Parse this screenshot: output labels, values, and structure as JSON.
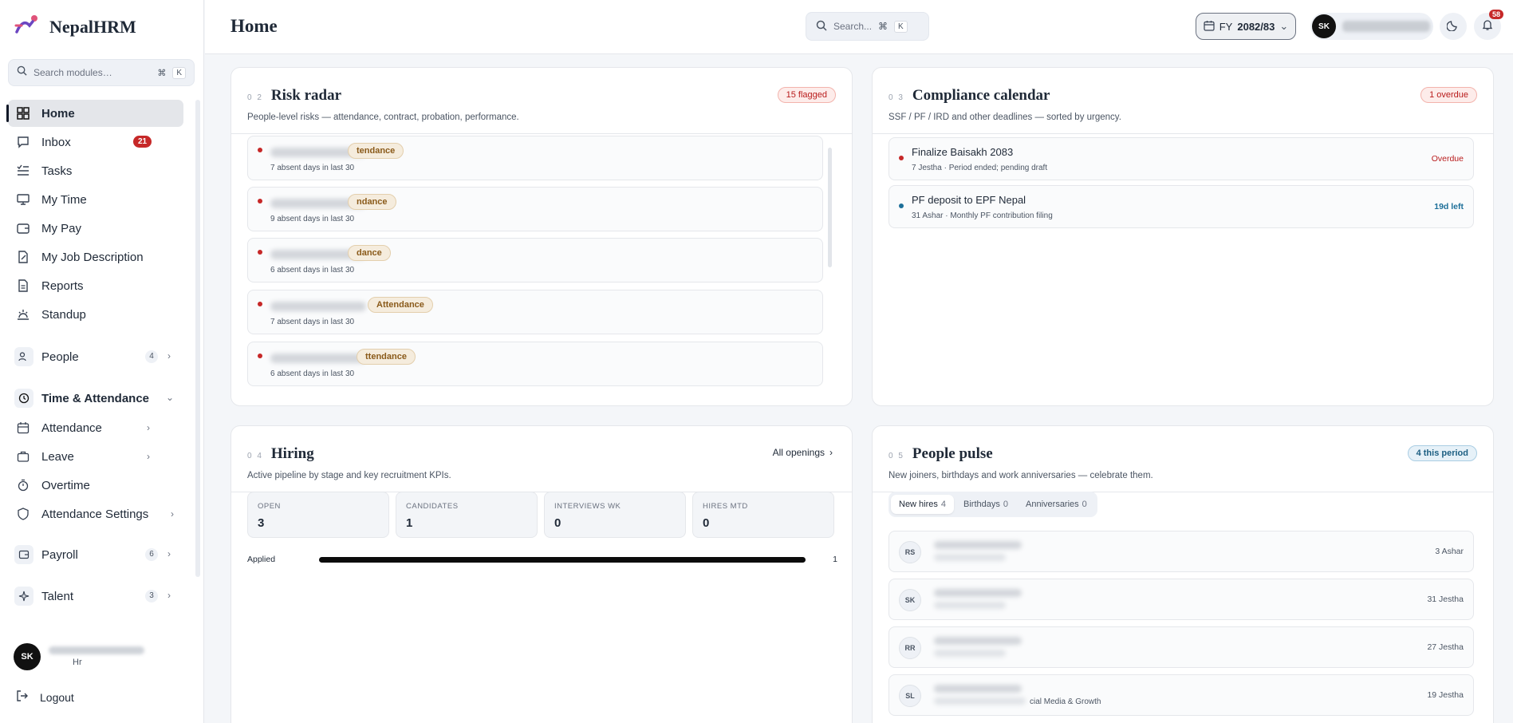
{
  "brand": {
    "name": "NepalHRM"
  },
  "sidebar": {
    "search_placeholder": "Search modules…",
    "kbd_cmd": "⌘",
    "kbd_k": "K",
    "items": [
      {
        "label": "Home",
        "icon": "grid-icon",
        "active": true
      },
      {
        "label": "Inbox",
        "icon": "message-icon",
        "count": "21"
      },
      {
        "label": "Tasks",
        "icon": "list-check-icon"
      },
      {
        "label": "My Time",
        "icon": "monitor-icon"
      },
      {
        "label": "My Pay",
        "icon": "wallet-icon"
      },
      {
        "label": "My Job Description",
        "icon": "file-edit-icon"
      },
      {
        "label": "Reports",
        "icon": "document-icon"
      },
      {
        "label": "Standup",
        "icon": "sunrise-icon"
      }
    ],
    "groups": {
      "people": {
        "label": "People",
        "count": "4"
      },
      "time_attendance": {
        "label": "Time & Attendance"
      },
      "attendance": {
        "label": "Attendance"
      },
      "leave": {
        "label": "Leave"
      },
      "overtime": {
        "label": "Overtime"
      },
      "attendance_settings": {
        "label": "Attendance Settings"
      },
      "payroll": {
        "label": "Payroll",
        "count": "6"
      },
      "talent": {
        "label": "Talent",
        "count": "3"
      }
    },
    "user": {
      "initials": "SK",
      "role": "Hr"
    },
    "logout": "Logout"
  },
  "topbar": {
    "title": "Home",
    "search_placeholder": "Search...",
    "kbd_cmd": "⌘",
    "kbd_k": "K",
    "fy_prefix": "FY",
    "fy_value": "2082/83",
    "user_initials": "SK",
    "notification_count": "58"
  },
  "risk": {
    "num": "0 2",
    "title": "Risk radar",
    "subtitle": "People-level risks — attendance, contract, probation, performance.",
    "badge": "15 flagged",
    "items": [
      {
        "tag": "tendance",
        "detail": "7 absent days in last 30"
      },
      {
        "tag": "ndance",
        "detail": "9 absent days in last 30"
      },
      {
        "tag": "dance",
        "detail": "6 absent days in last 30"
      },
      {
        "tag": "Attendance",
        "detail": "7 absent days in last 30"
      },
      {
        "tag": "ttendance",
        "detail": "6 absent days in last 30"
      }
    ]
  },
  "compliance": {
    "num": "0 3",
    "title": "Compliance calendar",
    "subtitle": "SSF / PF / IRD and other deadlines — sorted by urgency.",
    "badge": "1 overdue",
    "items": [
      {
        "title": "Finalize Baisakh 2083",
        "sub": "7 Jestha · Period ended; pending draft",
        "status": "Overdue",
        "dot_color": "#c62828",
        "status_color": "#b91c1c"
      },
      {
        "title": "PF deposit to EPF Nepal",
        "sub": "31 Ashar · Monthly PF contribution filing",
        "status": "19d left",
        "dot_color": "#1d6f99",
        "status_color": "#1d6f99"
      }
    ]
  },
  "hiring": {
    "num": "0 4",
    "title": "Hiring",
    "subtitle": "Active pipeline by stage and key recruitment KPIs.",
    "link": "All openings",
    "kpis": [
      {
        "label": "OPEN",
        "value": "3"
      },
      {
        "label": "CANDIDATES",
        "value": "1"
      },
      {
        "label": "INTERVIEWS WK",
        "value": "0"
      },
      {
        "label": "HIRES MTD",
        "value": "0"
      }
    ],
    "pipeline": [
      {
        "stage": "Applied",
        "count": "1",
        "fraction": 1.0
      }
    ]
  },
  "pulse": {
    "num": "0 5",
    "title": "People pulse",
    "subtitle": "New joiners, birthdays and work anniversaries — celebrate them.",
    "badge": "4 this period",
    "tabs": [
      {
        "label": "New hires",
        "count": "4"
      },
      {
        "label": "Birthdays",
        "count": "0"
      },
      {
        "label": "Anniversaries",
        "count": "0"
      }
    ],
    "people": [
      {
        "initials": "RS",
        "date": "3 Ashar"
      },
      {
        "initials": "SK",
        "date": "31 Jestha"
      },
      {
        "initials": "RR",
        "date": "27 Jestha"
      },
      {
        "initials": "SL",
        "date": "19 Jestha",
        "extra": "cial Media & Growth"
      }
    ]
  }
}
